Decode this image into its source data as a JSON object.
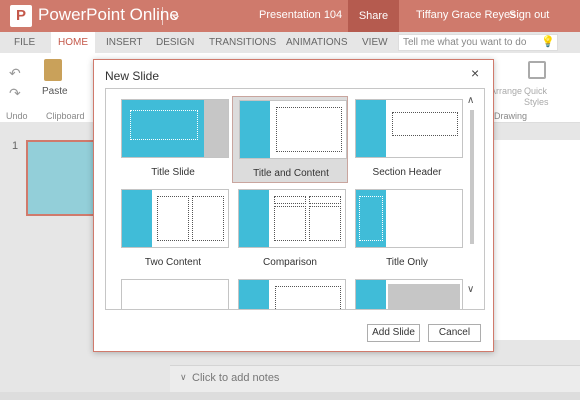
{
  "titlebar": {
    "logo_letter": "P",
    "app_name": "PowerPoint Online",
    "document": "Presentation 104",
    "share": "Share",
    "user": "Tiffany Grace Reyes",
    "sign_out": "Sign out",
    "brand_color": "#cf7a6c"
  },
  "ribbon_tabs": [
    "FILE",
    "HOME",
    "INSERT",
    "DESIGN",
    "TRANSITIONS",
    "ANIMATIONS",
    "VIEW"
  ],
  "active_tab": "HOME",
  "tell_me": {
    "placeholder": "Tell me what you want to do"
  },
  "ribbon": {
    "paste": "Paste",
    "undo_group": "Undo",
    "clipboard_group": "Clipboard",
    "arrange": "Arrange",
    "quick_styles_1": "Quick",
    "quick_styles_2": "Styles",
    "drawing_group": "Drawing"
  },
  "thumbnails": {
    "slide_number": "1"
  },
  "notes": {
    "placeholder": "Click to add notes"
  },
  "dialog": {
    "title": "New Slide",
    "close": "×",
    "layouts": [
      {
        "name": "Title Slide"
      },
      {
        "name": "Title and Content",
        "selected": true
      },
      {
        "name": "Section Header"
      },
      {
        "name": "Two Content"
      },
      {
        "name": "Comparison"
      },
      {
        "name": "Title Only"
      }
    ],
    "add_button": "Add Slide",
    "cancel_button": "Cancel",
    "accent_color": "#40bcd8"
  }
}
